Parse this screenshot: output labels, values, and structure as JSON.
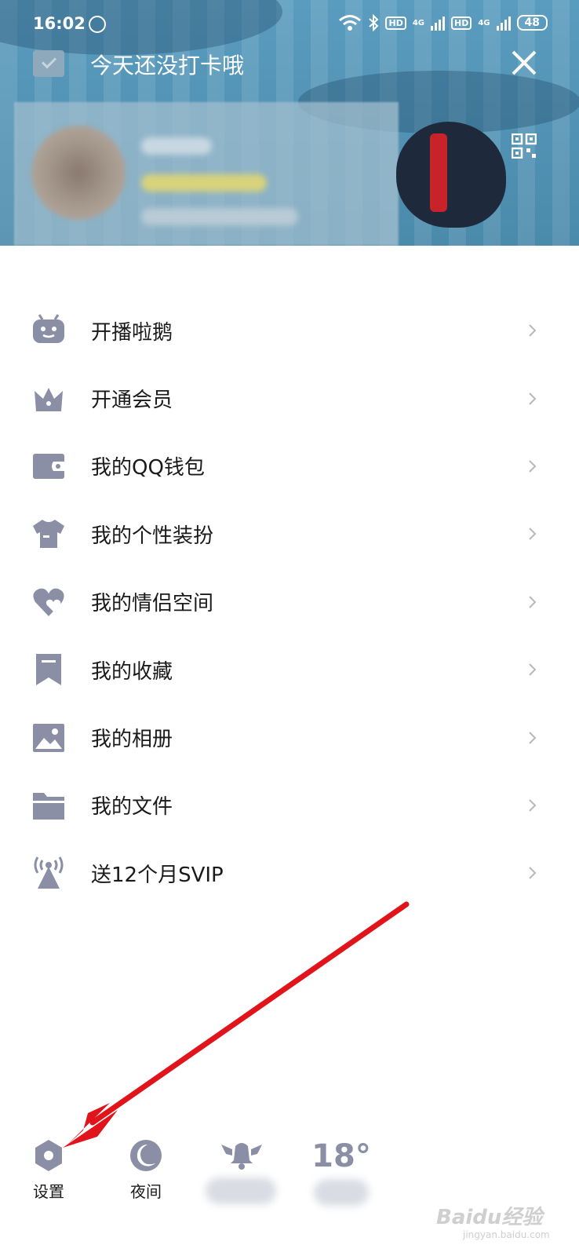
{
  "status_bar": {
    "time": "16:02",
    "network_1": "4G",
    "network_2": "4G",
    "hd_1": "HD",
    "hd_2": "HD",
    "battery": "48"
  },
  "header": {
    "checkin_text": "今天还没打卡哦",
    "icons": [
      "calendar-check-icon",
      "close-icon",
      "qr-code-icon"
    ]
  },
  "menu": {
    "items": [
      {
        "label": "开播啦鹅",
        "icon": "tv-robot-icon"
      },
      {
        "label": "开通会员",
        "icon": "crown-icon"
      },
      {
        "label": "我的QQ钱包",
        "icon": "wallet-icon"
      },
      {
        "label": "我的个性装扮",
        "icon": "tshirt-icon"
      },
      {
        "label": "我的情侣空间",
        "icon": "heart-icon"
      },
      {
        "label": "我的收藏",
        "icon": "bookmark-icon"
      },
      {
        "label": "我的相册",
        "icon": "photo-icon"
      },
      {
        "label": "我的文件",
        "icon": "folder-icon"
      },
      {
        "label": "送12个月SVIP",
        "icon": "broadcast-tower-icon"
      }
    ]
  },
  "bottom_bar": {
    "settings_label": "设置",
    "night_label": "夜间",
    "temperature": "18°"
  },
  "colors": {
    "icon_gray": "#8a8fa6",
    "header_blue": "#4e8fb0",
    "annotation_red": "#e0141a"
  },
  "watermark": {
    "main": "Baidu经验",
    "sub": "jingyan.baidu.com"
  }
}
